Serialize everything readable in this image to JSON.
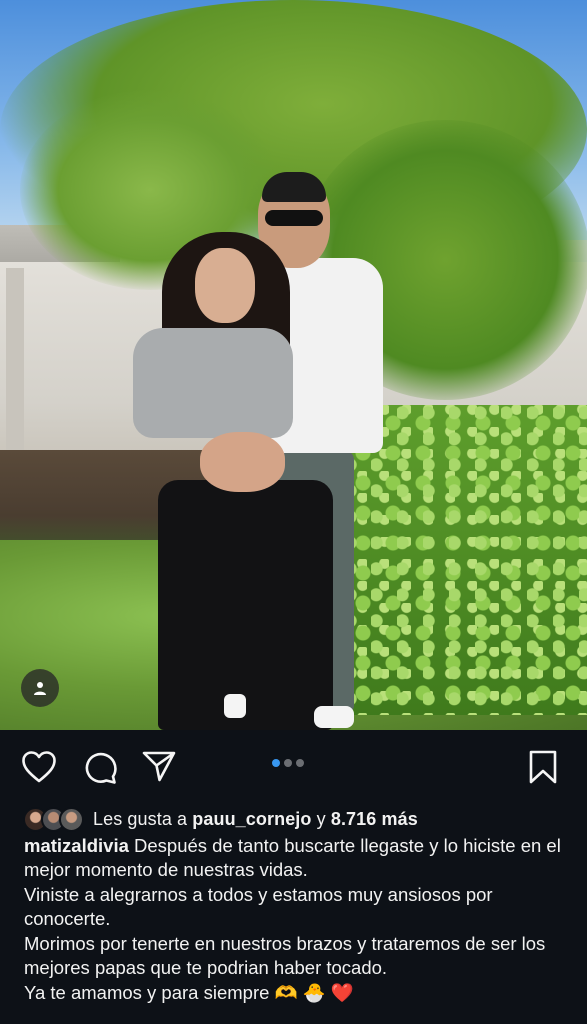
{
  "post": {
    "carousel": {
      "count": 3,
      "active_index": 0
    },
    "likes": {
      "prefix": "Les gusta a",
      "user": "pauu_cornejo",
      "connector": "y",
      "count_text": "8.716 más"
    },
    "caption": {
      "username": "matizaldivia",
      "lines": [
        "Después de tanto buscarte llegaste y lo hiciste en el mejor momento de nuestras vidas.",
        "Viniste a alegrarnos a todos y estamos muy ansiosos por conocerte.",
        "Morimos por tenerte en nuestros brazos y trataremos de ser los mejores papas que te podrian haber tocado.",
        "Ya te amamos y para siempre"
      ],
      "emojis": [
        "🫶",
        "🐣",
        "❤️"
      ]
    }
  },
  "icons": {
    "like": "heart-icon",
    "comment": "comment-icon",
    "share": "paper-plane-icon",
    "save": "bookmark-icon",
    "tag": "person-icon"
  },
  "colors": {
    "background": "#0d1117",
    "text": "#f2f2f2",
    "carousel_active": "#3897f0",
    "carousel_inactive": "#6b6e73"
  }
}
